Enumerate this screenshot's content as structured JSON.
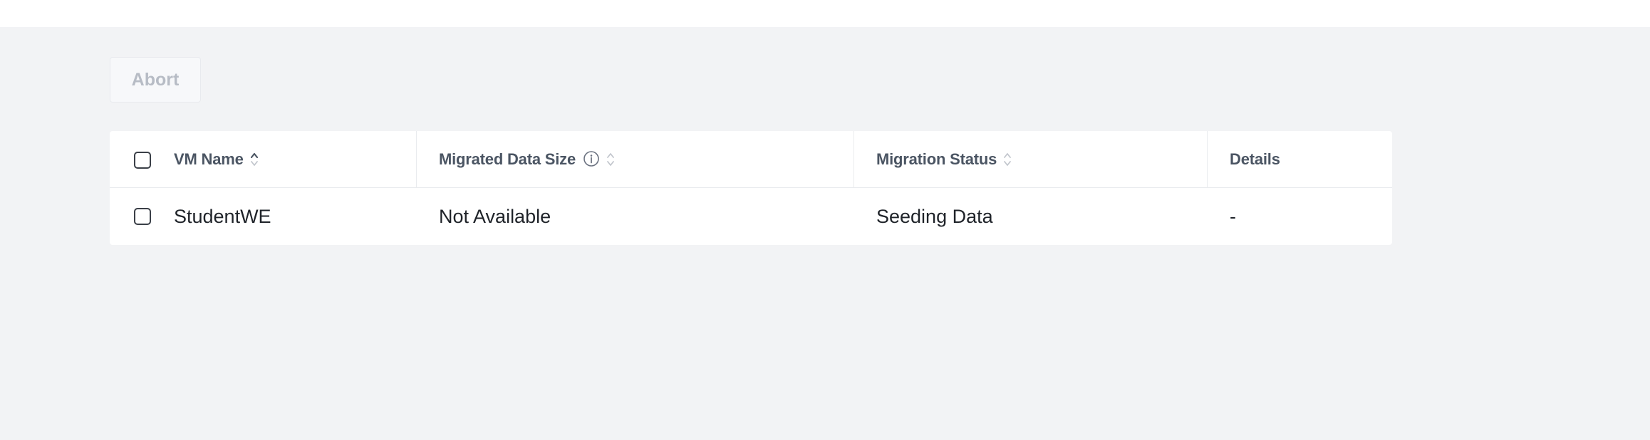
{
  "toolbar": {
    "abort_label": "Abort"
  },
  "table": {
    "columns": {
      "vm_name": "VM Name",
      "migrated_data_size": "Migrated Data Size",
      "migration_status": "Migration Status",
      "details": "Details"
    },
    "rows": [
      {
        "vm_name": "StudentWE",
        "migrated_data_size": "Not Available",
        "migration_status": "Seeding Data",
        "details": "-"
      }
    ]
  },
  "icons": {
    "sort_active": "sort-ascending-icon",
    "sort_inactive": "sort-icon",
    "info": "info-icon"
  },
  "colors": {
    "background": "#f2f3f5",
    "card": "#ffffff",
    "header_text": "#4b5563",
    "cell_text": "#1f2329",
    "disabled_button_text": "#b7bcc5"
  }
}
